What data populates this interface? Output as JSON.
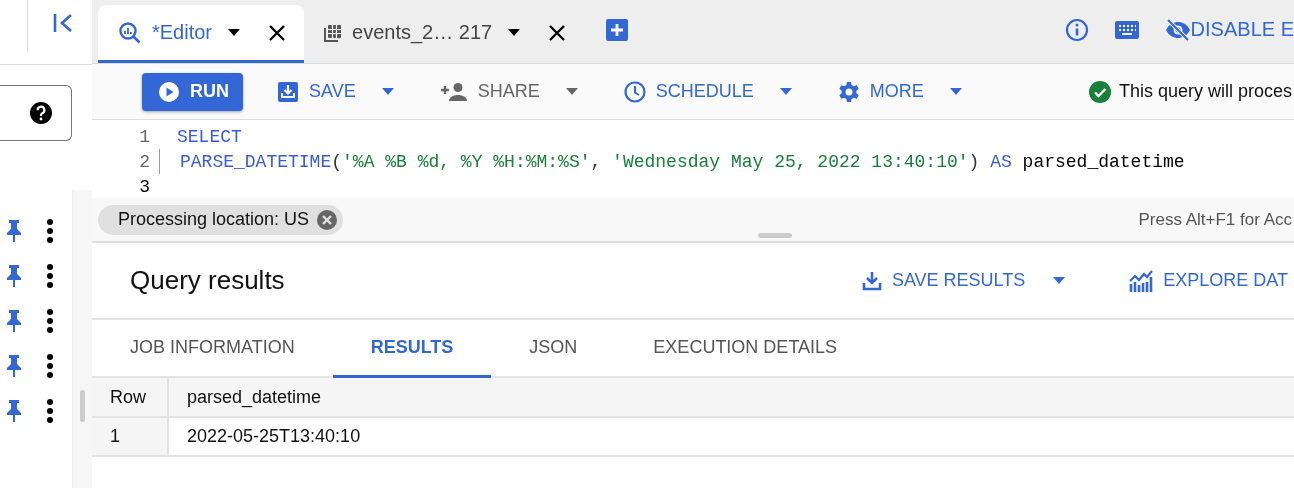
{
  "sidebar": {
    "items": [
      {
        "pinned": true
      },
      {
        "pinned": true
      },
      {
        "pinned": true
      },
      {
        "pinned": true
      },
      {
        "pinned": true
      }
    ]
  },
  "tabs": [
    {
      "label": "*Editor",
      "kind": "query",
      "selected": true
    },
    {
      "label": "events_2… 217",
      "kind": "table",
      "selected": false
    }
  ],
  "header_actions": {
    "disable_link": "DISABLE E"
  },
  "toolbar": {
    "buttons": [
      {
        "label": "RUN",
        "kind": "run",
        "dropdown": false,
        "disabled": false
      },
      {
        "label": "SAVE",
        "kind": "save",
        "dropdown": true,
        "disabled": false
      },
      {
        "label": "SHARE",
        "kind": "share",
        "dropdown": true,
        "disabled": true
      },
      {
        "label": "SCHEDULE",
        "kind": "schedule",
        "dropdown": true,
        "disabled": false
      },
      {
        "label": "MORE",
        "kind": "more",
        "dropdown": true,
        "disabled": false
      }
    ],
    "status": {
      "text": "This query will proces",
      "valid": true
    }
  },
  "editor": {
    "lines": [
      {
        "number": "1",
        "current": false,
        "guide": false,
        "tokens": [
          {
            "kind": "keyword",
            "text": "SELECT"
          }
        ]
      },
      {
        "number": "2",
        "current": false,
        "guide": true,
        "tokens": [
          {
            "kind": "function",
            "text": "PARSE_DATETIME"
          },
          {
            "kind": "punct",
            "text": "("
          },
          {
            "kind": "string",
            "text": "'%A %B %d, %Y %H:%M:%S'"
          },
          {
            "kind": "punct",
            "text": ", "
          },
          {
            "kind": "string",
            "text": "'Wednesday May 25, 2022 13:40:10'"
          },
          {
            "kind": "punct",
            "text": ") "
          },
          {
            "kind": "keyword",
            "text": "AS"
          },
          {
            "kind": "ident",
            "text": " parsed_datetime"
          }
        ]
      },
      {
        "number": "3",
        "current": true,
        "guide": false
      }
    ]
  },
  "status_bar": {
    "chip": "Processing location: US",
    "hint": "Press Alt+F1 for Acc"
  },
  "results": {
    "title": "Query results",
    "actions": [
      {
        "label": "SAVE RESULTS",
        "kind": "download",
        "dropdown": true
      },
      {
        "label": "EXPLORE DAT",
        "kind": "chart",
        "dropdown": false
      }
    ],
    "tabs": [
      {
        "label": "JOB INFORMATION",
        "selected": false
      },
      {
        "label": "RESULTS",
        "selected": true
      },
      {
        "label": "JSON",
        "selected": false
      },
      {
        "label": "EXECUTION DETAILS",
        "selected": false
      }
    ],
    "table": {
      "columns": [
        "Row",
        "parsed_datetime"
      ],
      "rows": [
        [
          "1",
          "2022-05-25T13:40:10"
        ]
      ]
    }
  }
}
